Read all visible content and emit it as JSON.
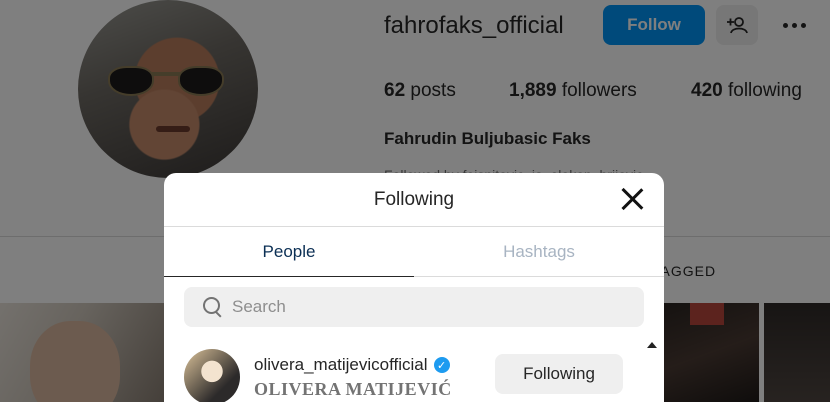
{
  "profile": {
    "username": "fahrofaks_official",
    "follow_label": "Follow",
    "posts_count": "62",
    "posts_label": "posts",
    "followers_count": "1,889",
    "followers_label": "followers",
    "following_count": "420",
    "following_label": "following",
    "full_name": "Fahrudin Buljubasic Faks",
    "followed_by": "Followed by fejsnitevic, ja_elekop, brijovic",
    "tagged_tab": "TAGGED"
  },
  "modal": {
    "title": "Following",
    "tabs": [
      {
        "label": "People",
        "active": true
      },
      {
        "label": "Hashtags",
        "active": false
      }
    ],
    "search": {
      "placeholder": "Search",
      "value": ""
    },
    "items": [
      {
        "username": "olivera_matijevicofficial",
        "verified": true,
        "full_name": "OLIVERA MATIJEVIĆ",
        "button_label": "Following"
      }
    ]
  },
  "colors": {
    "accent": "#0095f6",
    "verified": "#1d9bf0",
    "active_tab": "#0b2f54",
    "inactive_tab": "#a8b4c2"
  },
  "icons": [
    "add-user-icon",
    "more-options-icon",
    "close-icon",
    "search-icon",
    "verified-badge-icon",
    "scroll-up-arrow-icon"
  ]
}
